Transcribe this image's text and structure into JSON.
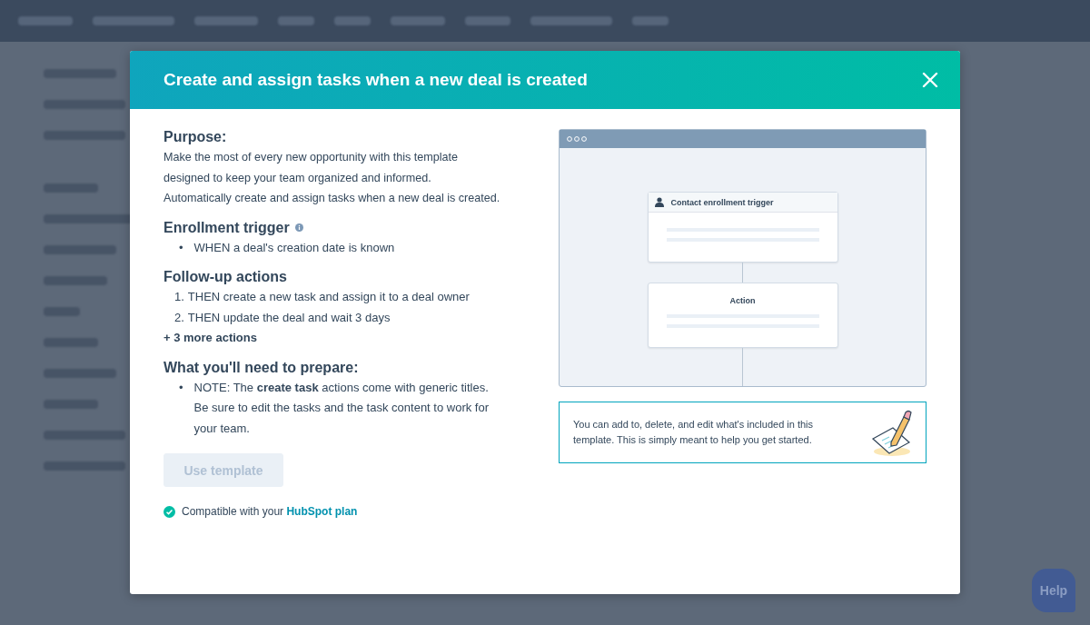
{
  "modal": {
    "title": "Create and assign tasks when a new deal is created",
    "purpose": {
      "heading": "Purpose:",
      "text": "Make the most of every new opportunity with this template designed to keep your team organized and informed. Automatically create and assign tasks when a new deal is created."
    },
    "enrollment_trigger": {
      "heading": "Enrollment trigger",
      "items": [
        {
          "marker": "•",
          "text": "WHEN a deal's creation date is known"
        }
      ]
    },
    "follow_up_actions": {
      "heading": "Follow-up actions",
      "items": [
        {
          "marker": "1.",
          "text": "THEN create a new task and assign it to a deal owner"
        },
        {
          "marker": "2.",
          "text": "THEN update the deal and wait 3 days"
        }
      ],
      "more": "+ 3 more actions"
    },
    "prepare": {
      "heading": "What you'll need to prepare:",
      "items": [
        {
          "marker": "•",
          "text": "NOTE: The **create task** actions come with generic titles. Be sure to edit the tasks and the task content to work for your team."
        }
      ]
    },
    "use_template": {
      "label": "Use template",
      "disabled": true
    },
    "compatibility": {
      "text": "Compatible with your",
      "link": "HubSpot plan"
    },
    "preview": {
      "trigger_card": "Contact enrollment trigger",
      "action_card": "Action"
    },
    "tip": "You can add to, delete, and edit what's included in this template. This is simply meant to help you get started."
  },
  "help_button": "Help"
}
